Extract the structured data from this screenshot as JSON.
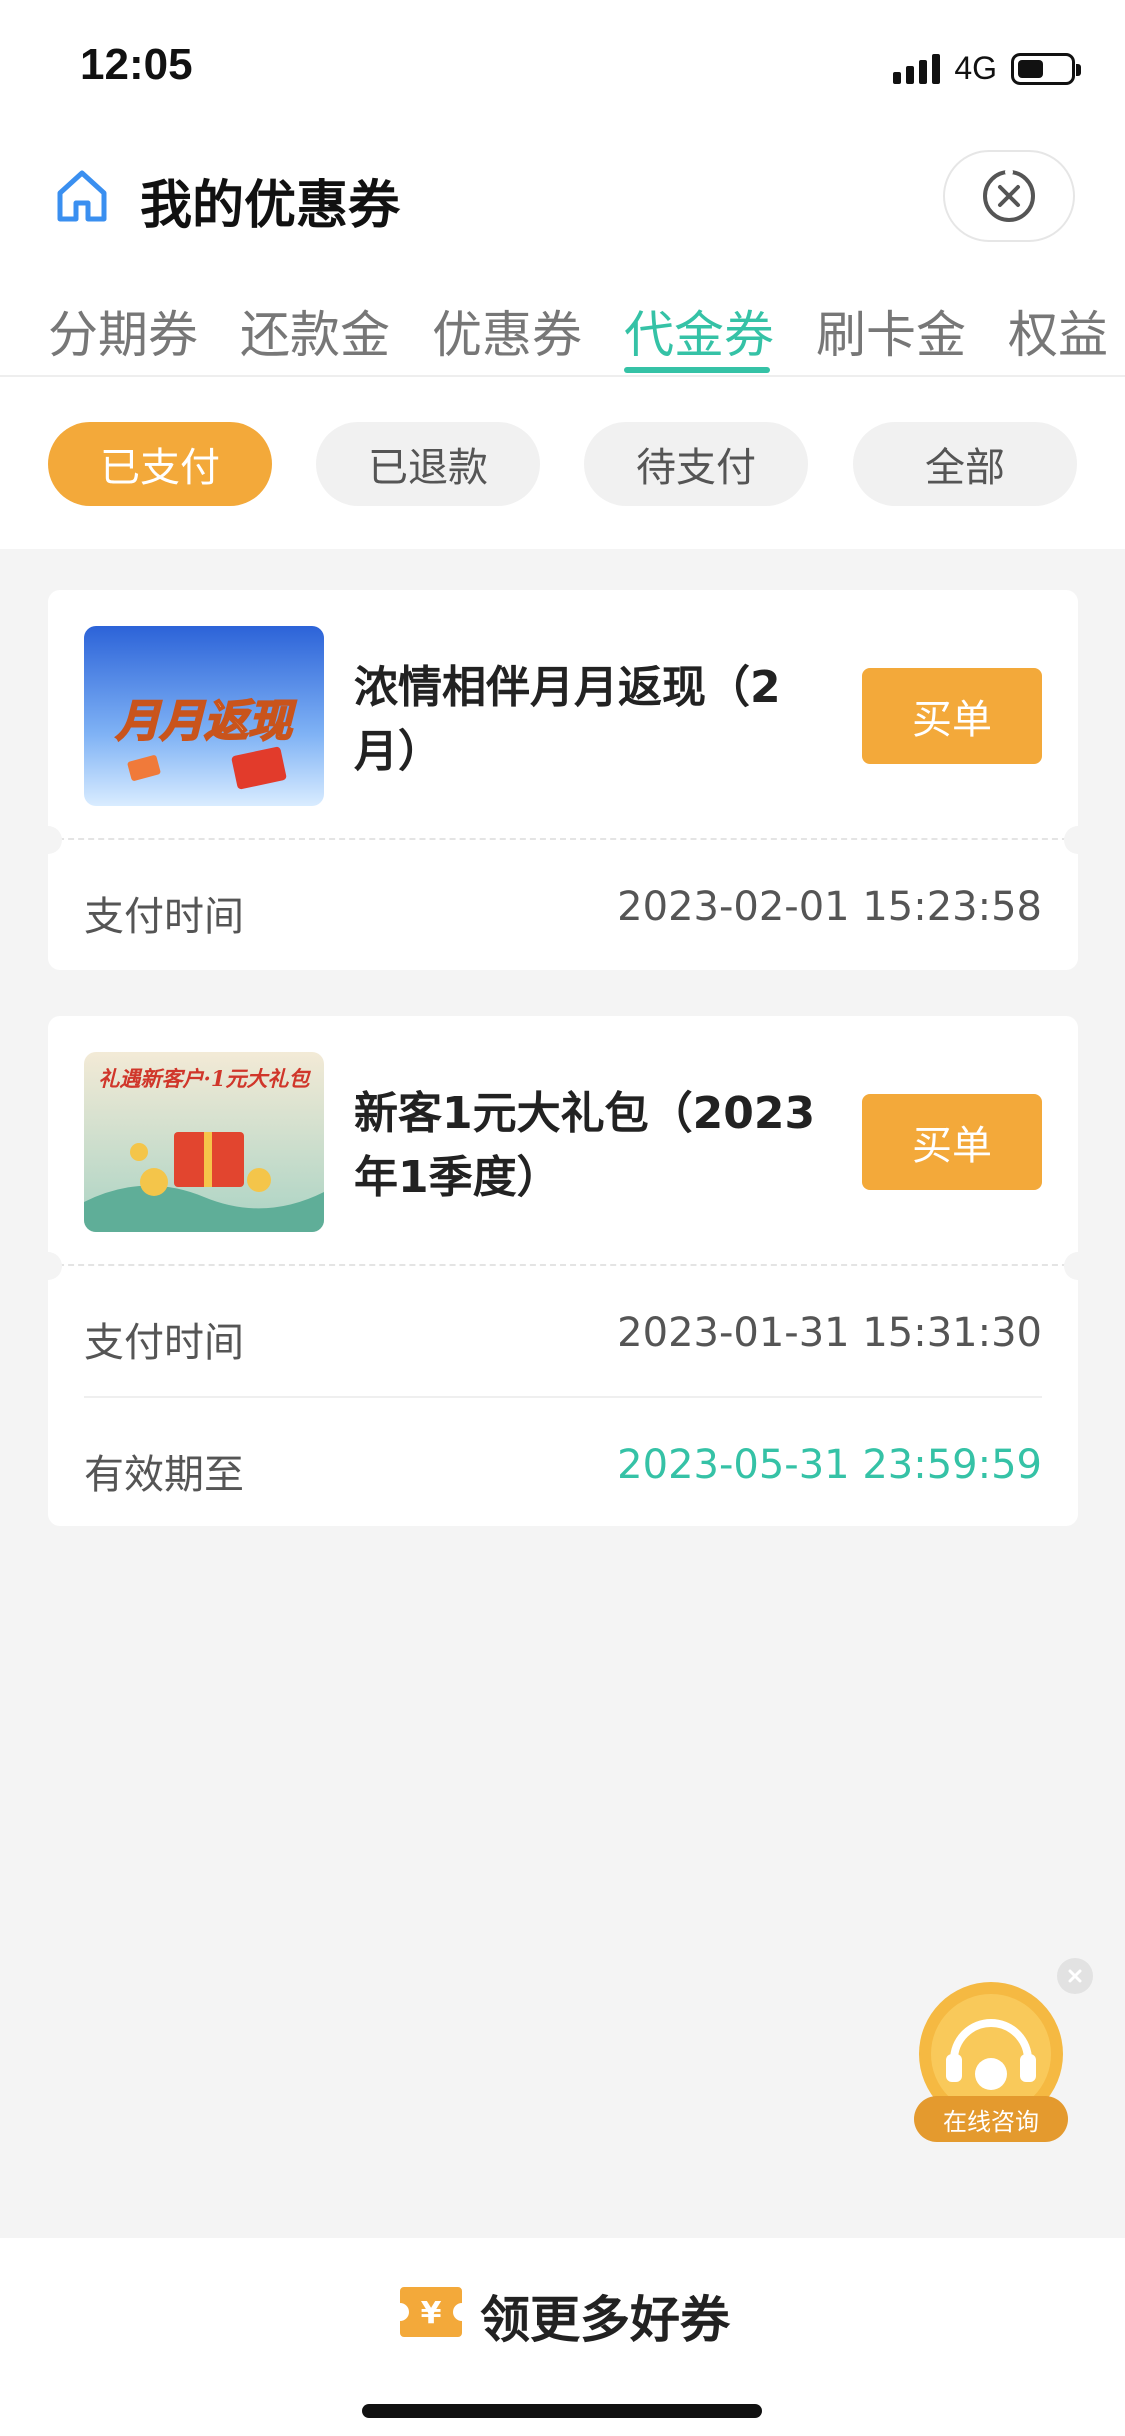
{
  "status_bar": {
    "time": "12:05",
    "network": "4G"
  },
  "header": {
    "title": "我的优惠券"
  },
  "tabs": [
    {
      "label": "分期券"
    },
    {
      "label": "还款金"
    },
    {
      "label": "优惠券"
    },
    {
      "label": "代金券"
    },
    {
      "label": "刷卡金"
    },
    {
      "label": "权益"
    }
  ],
  "active_tab": "代金券",
  "filters": [
    {
      "label": "已支付"
    },
    {
      "label": "已退款"
    },
    {
      "label": "待支付"
    },
    {
      "label": "全部"
    }
  ],
  "active_filter": "已支付",
  "cards": [
    {
      "thumb_text": "月月返现",
      "title": "浓情相伴月月返现（2月）",
      "button": "买单",
      "rows": [
        {
          "label": "支付时间",
          "value": "2023-02-01 15:23:58"
        }
      ]
    },
    {
      "thumb_text": "礼遇新客户·1元大礼包",
      "title": "新客1元大礼包（2023年1季度）",
      "button": "买单",
      "rows": [
        {
          "label": "支付时间",
          "value": "2023-01-31 15:31:30"
        },
        {
          "label": "有效期至",
          "value": "2023-05-31 23:59:59"
        }
      ]
    }
  ],
  "consult": {
    "label": "在线咨询"
  },
  "bottom_bar": {
    "label": "领更多好券"
  },
  "colors": {
    "accent": "#35c2a6",
    "orange": "#f3a93a",
    "background": "#f4f4f4"
  },
  "icons": {
    "home": "home-icon",
    "close": "close-icon",
    "coupon": "coupon-icon",
    "headset": "headset-icon"
  }
}
